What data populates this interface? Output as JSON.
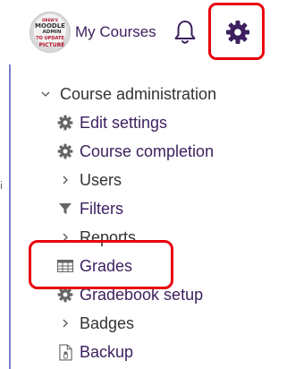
{
  "header": {
    "avatar_text": [
      "DREW'S",
      "MOODLE",
      "ADMIN",
      "TO UPDATE",
      "PICTURE"
    ],
    "my_courses_label": "My Courses",
    "bell_icon": "bell-icon",
    "settings_icon": "gear-icon"
  },
  "menu": {
    "section_label": "Course administration",
    "items": [
      {
        "label": "Edit settings",
        "icon": "gear-icon",
        "kind": "link"
      },
      {
        "label": "Course completion",
        "icon": "gear-icon",
        "kind": "link"
      },
      {
        "label": "Users",
        "icon": "chevron-right-icon",
        "kind": "branch"
      },
      {
        "label": "Filters",
        "icon": "filter-icon",
        "kind": "link"
      },
      {
        "label": "Reports",
        "icon": "chevron-right-icon",
        "kind": "branch"
      },
      {
        "label": "Grades",
        "icon": "table-icon",
        "kind": "link"
      },
      {
        "label": "Gradebook setup",
        "icon": "gear-icon",
        "kind": "link"
      },
      {
        "label": "Badges",
        "icon": "chevron-right-icon",
        "kind": "branch"
      },
      {
        "label": "Backup",
        "icon": "file-icon",
        "kind": "link"
      }
    ]
  },
  "colors": {
    "link": "#3c1f5e",
    "highlight": "#e8000d",
    "text": "#333333"
  }
}
